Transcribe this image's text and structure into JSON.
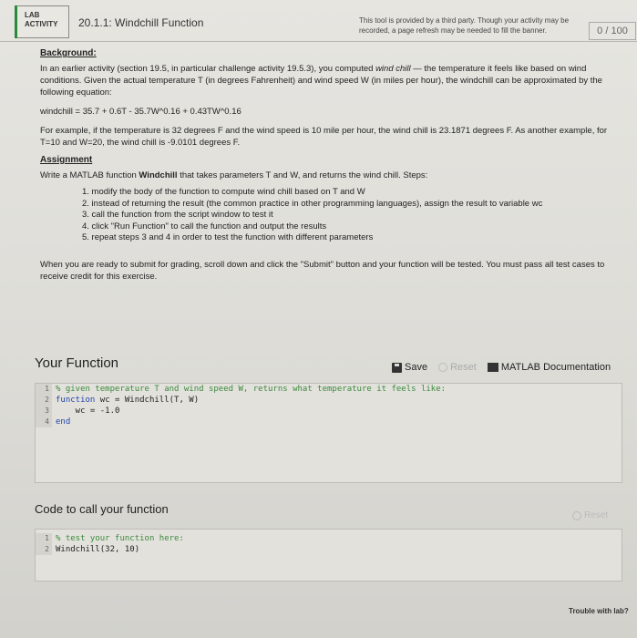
{
  "header": {
    "lab_label_1": "LAB",
    "lab_label_2": "ACTIVITY",
    "activity_title": "20.1.1: Windchill Function",
    "third_party_notice": "This tool is provided by a third party. Though your activity may be recorded, a page refresh may be needed to fill the banner.",
    "score": "0 / 100"
  },
  "instructions": {
    "background_heading": "Background:",
    "background_text_1": "In an earlier activity (section 19.5, in particular challenge activity 19.5.3), you computed ",
    "background_emph": "wind chill",
    "background_text_2": " — the temperature it feels like based on wind conditions.  Given the actual temperature T (in degrees Fahrenheit) and wind speed W (in miles per hour), the windchill can be approximated by the following equation:",
    "equation": "windchill = 35.7 + 0.6T - 35.7W^0.16 + 0.43TW^0.16",
    "example": "For example, if the temperature is 32 degrees F and the wind speed is 10 mile per hour, the wind chill is 23.1871 degrees F.  As another example, for T=10 and W=20, the wind chill is -9.0101 degrees F.",
    "assignment_heading": "Assignment",
    "assignment_text_1": "Write a MATLAB function ",
    "assignment_func": "Windchill",
    "assignment_text_2": " that takes parameters T and W, and returns the wind chill.  Steps:",
    "steps": [
      "1. modify the body of the function to compute wind chill based on T and W",
      "2. instead of returning the result (the common practice in other programming languages), assign the result to variable wc",
      "3. call the function from the script window to test it",
      "4. click \"Run Function\" to call the function and output the results",
      "5. repeat steps 3 and 4 in order to test the function with different parameters"
    ],
    "submit_note": "When you are ready to submit for grading, scroll down and click the \"Submit\" button and your function will be tested.  You must pass all test cases to receive credit for this exercise."
  },
  "your_function": {
    "title": "Your Function",
    "save_label": "Save",
    "reset_label": "Reset",
    "doc_label": "MATLAB Documentation",
    "lines": [
      {
        "num": "1",
        "text": "% given temperature T and wind speed W, returns what temperature it feels like:"
      },
      {
        "num": "2",
        "kw": "function",
        "text": " wc = Windchill(T, W)"
      },
      {
        "num": "3",
        "text": "    wc = -1.0"
      },
      {
        "num": "4",
        "kw": "end",
        "text": ""
      }
    ]
  },
  "call_function": {
    "title": "Code to call your function",
    "reset_label": "Reset",
    "lines": [
      {
        "num": "1",
        "text": "% test your function here:"
      },
      {
        "num": "2",
        "text": "Windchill(32, 10)"
      }
    ]
  },
  "footer": {
    "trouble_link": "Trouble with lab?"
  },
  "colors": {
    "accent_green": "#2a8a3a",
    "comment_green": "#3c8a3c",
    "keyword_blue": "#2244aa"
  }
}
